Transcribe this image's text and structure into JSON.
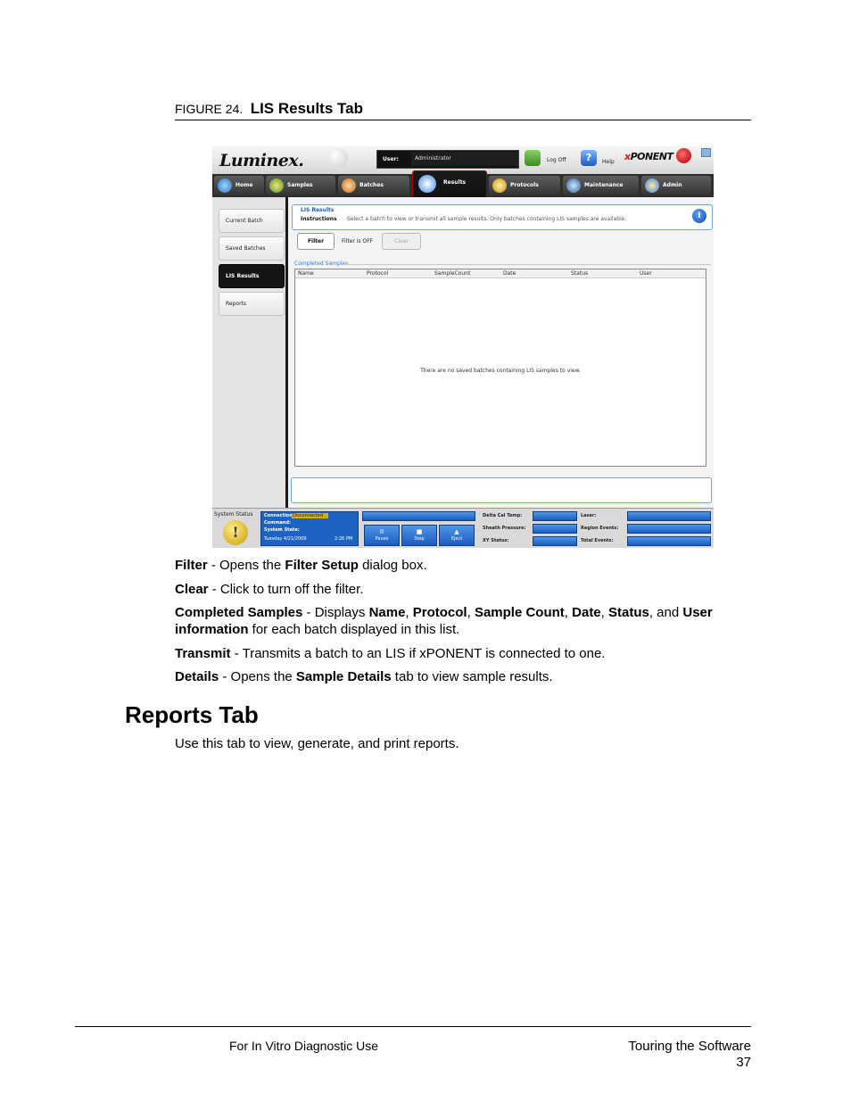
{
  "figure": {
    "number": "FIGURE 24.",
    "title": "LIS Results Tab"
  },
  "app": {
    "logo": "Luminex.",
    "user_label": "User:",
    "user_value": "Administrator",
    "logoff_label": "Log Off",
    "help_label": "Help",
    "brand_x": "x",
    "brand_rest": "PONENT",
    "nav_tabs": [
      "Home",
      "Samples",
      "Batches",
      "Results",
      "Protocols",
      "Maintenance",
      "Admin"
    ],
    "active_tab": "Results",
    "side_items": [
      "Current Batch",
      "Saved Batches",
      "LIS Results",
      "Reports"
    ],
    "active_side": "LIS Results",
    "panel_title": "LIS Results",
    "instructions_label": "Instructions",
    "instructions_text": "Select a batch to view or transmit all sample results. Only batches containing LIS samples are available.",
    "filter_button": "Filter",
    "filter_status": "Filter is OFF",
    "clear_button": "Clear",
    "group_label": "Completed Samples",
    "columns": [
      "Name",
      "Protocol",
      "SampleCount",
      "Date",
      "Status",
      "User"
    ],
    "empty_message": "There are no saved batches containing LIS samples to view.",
    "status": {
      "system_status_label": "System Status",
      "connection_label": "Connection:",
      "connection_value": "Disconnected",
      "command_label": "Command:",
      "system_state_label": "System State:",
      "date_text": "Tuesday 4/21/2009",
      "time_text": "2:26 PM",
      "pause": "Pause",
      "stop": "Stop",
      "eject": "Eject",
      "delta_cal_temp": "Delta Cal Temp:",
      "sheath_pressure": "Sheath Pressure:",
      "xy_status": "XY Status:",
      "laser": "Laser:",
      "region_events": "Region Events:",
      "total_events": "Total Events:"
    }
  },
  "descriptions": {
    "filter": {
      "term": "Filter",
      "t1": " - Opens the ",
      "b1": "Filter Setup",
      "t2": " dialog box."
    },
    "clear": {
      "term": "Clear",
      "t1": " - Click to turn off the filter."
    },
    "completed": {
      "term": "Completed Samples",
      "t1": " - Displays ",
      "b1": "Name",
      "s1": ", ",
      "b2": "Protocol",
      "s2": ", ",
      "b3": "Sample Count",
      "s3": ", ",
      "b4": "Date",
      "s4": ", ",
      "b5": "Status",
      "s5": ", and ",
      "b6": "User information",
      "t2": " for each batch displayed in this list."
    },
    "transmit": {
      "term": "Transmit",
      "t1": " - Transmits a batch to an LIS if xPONENT is connected to one."
    },
    "details": {
      "term": "Details",
      "t1": " - Opens the ",
      "b1": "Sample Details",
      "t2": " tab to view sample results."
    }
  },
  "section": {
    "heading": "Reports Tab",
    "intro": "Use this tab to view, generate, and print reports."
  },
  "footer": {
    "left": "For In Vitro Diagnostic Use",
    "right_title": "Touring the Software",
    "page_number": "37"
  }
}
